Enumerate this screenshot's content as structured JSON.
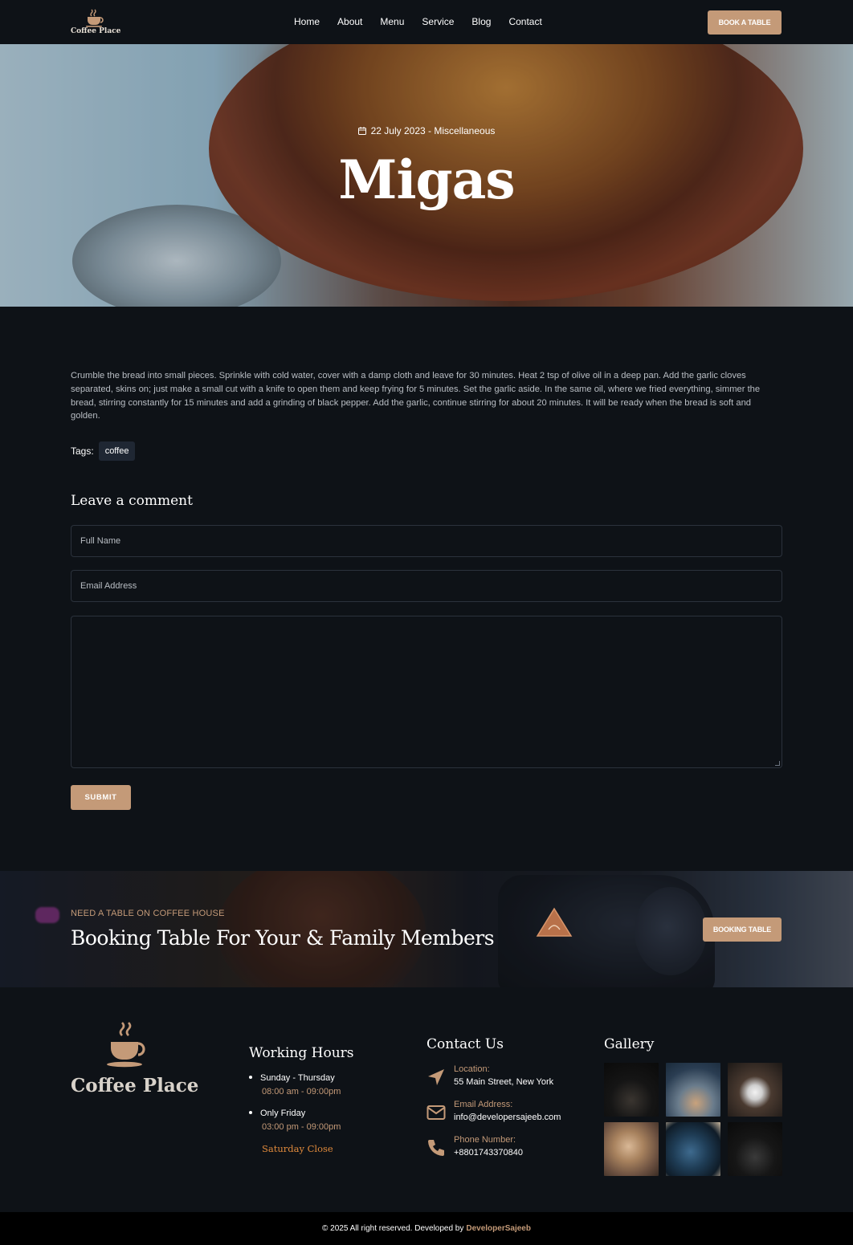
{
  "nav": {
    "logo_text": "Coffee Place",
    "links": [
      "Home",
      "About",
      "Menu",
      "Service",
      "Blog",
      "Contact"
    ],
    "cta": "BOOK A TABLE"
  },
  "hero": {
    "meta": "22 July 2023 - Miscellaneous",
    "title": "Migas"
  },
  "article": {
    "body": "Crumble the bread into small pieces. Sprinkle with cold water, cover with a damp cloth and leave for 30 minutes. Heat 2 tsp of olive oil in a deep pan. Add the garlic cloves separated, skins on; just make a small cut with a knife to open them and keep frying for 5 minutes. Set the garlic aside. In the same oil, where we fried everything, simmer the bread, stirring constantly for 15 minutes and add a grinding of black pepper. Add the garlic, continue stirring for about 20 minutes. It will be ready when the bread is soft and golden.",
    "tags_label": "Tags:",
    "tags": [
      "coffee"
    ]
  },
  "comment": {
    "title": "Leave a comment",
    "name_placeholder": "Full Name",
    "email_placeholder": "Email Address",
    "submit": "SUBMIT"
  },
  "banner": {
    "kicker": "NEED A TABLE ON COFFEE HOUSE",
    "title": "Booking Table For Your & Family Members",
    "cta": "BOOKING TABLE"
  },
  "footer": {
    "logo_text": "Coffee Place",
    "hours": {
      "title": "Working Hours",
      "items": [
        {
          "days": "Sunday - Thursday",
          "time": "08:00 am - 09:00pm"
        },
        {
          "days": "Only Friday",
          "time": "03:00 pm - 09:00pm"
        }
      ],
      "note": "Saturday Close"
    },
    "contact": {
      "title": "Contact Us",
      "items": [
        {
          "label": "Location:",
          "value": "55 Main Street, New York",
          "icon": "location-arrow-icon"
        },
        {
          "label": "Email Address:",
          "value": "info@developersajeeb.com",
          "icon": "envelope-icon"
        },
        {
          "label": "Phone Number:",
          "value": "+8801743370840",
          "icon": "phone-icon"
        }
      ]
    },
    "gallery": {
      "title": "Gallery"
    }
  },
  "copyright": {
    "text": "© 2025 All right reserved. Developed by",
    "developer": "DeveloperSajeeb"
  },
  "colors": {
    "accent": "#c49a78",
    "background": "#0e1217",
    "saturday_note": "#e08a3c"
  }
}
